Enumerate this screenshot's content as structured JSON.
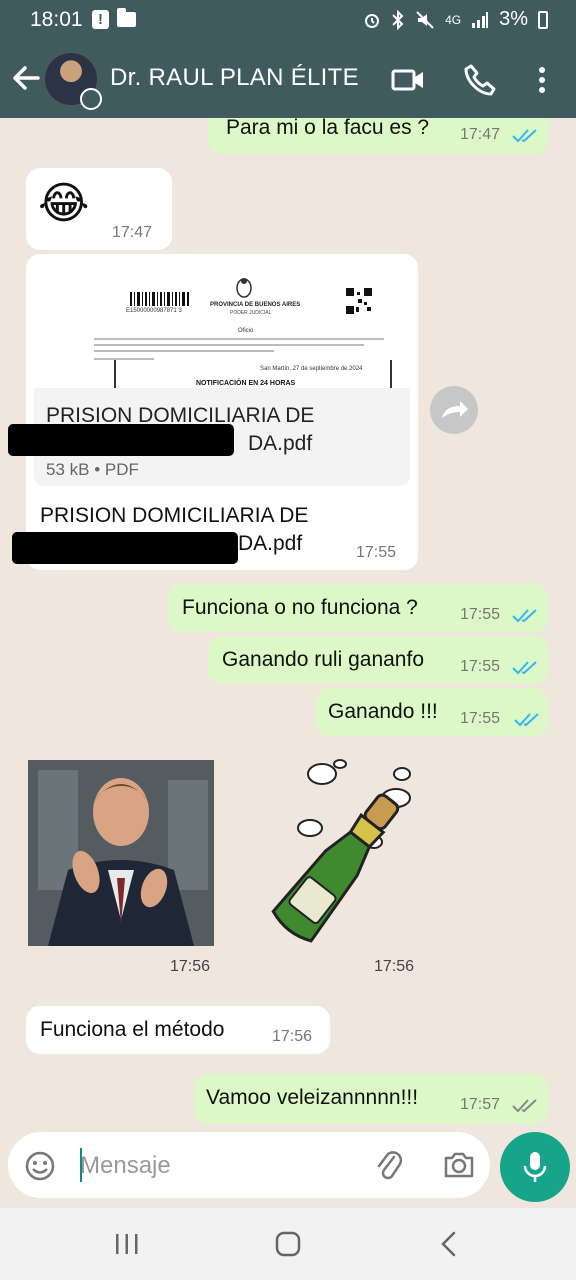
{
  "status_bar": {
    "time": "18:01",
    "network": "4G",
    "battery": "3%"
  },
  "header": {
    "contact_name": "Dr. RAUL PLAN ÉLITE"
  },
  "messages": [
    {
      "text": "Para mi o la facu es ?",
      "time": "17:47",
      "direction": "out",
      "read": true
    },
    {
      "emoji": "😂",
      "time": "17:47",
      "direction": "in"
    },
    {
      "direction": "in",
      "time": "17:55",
      "document": {
        "preview_header": "PROVINCIA DE BUENOS AIRES",
        "preview_sub": "PODER JUDICIAL",
        "preview_office": "Oficio",
        "preview_barcode": "E15000000987871 3",
        "preview_date": "San Martín, 27 de septiembre de 2024",
        "preview_notice": "NOTIFICACIÓN EN 24 HORAS",
        "name_line1": "PRISION DOMICILIARIA DE",
        "name_line2_visible": "DA.pdf",
        "meta": "53 kB • PDF"
      },
      "caption_line1": "PRISION DOMICILIARIA DE",
      "caption_line2_visible": "DA.pdf"
    },
    {
      "text": "Funciona o no funciona ?",
      "time": "17:55",
      "direction": "out",
      "read": true
    },
    {
      "text": "Ganando ruli gananfo",
      "time": "17:55",
      "direction": "out",
      "read": true
    },
    {
      "text": "Ganando !!!",
      "time": "17:55",
      "direction": "out",
      "read": true
    },
    {
      "type": "gif",
      "time": "17:56",
      "direction": "in"
    },
    {
      "type": "sticker",
      "time": "17:56",
      "direction": "in"
    },
    {
      "text": "Funciona el método",
      "time": "17:56",
      "direction": "in"
    },
    {
      "text": "Vamoo veleizannnnn!!!",
      "time": "17:57",
      "direction": "out",
      "read": false
    }
  ],
  "input": {
    "placeholder": "Mensaje"
  },
  "colors": {
    "header": "#3f5b5e",
    "outgoing": "#dcf8c6",
    "incoming": "#ffffff",
    "read_ticks": "#34b7f1",
    "accent": "#17a589"
  }
}
